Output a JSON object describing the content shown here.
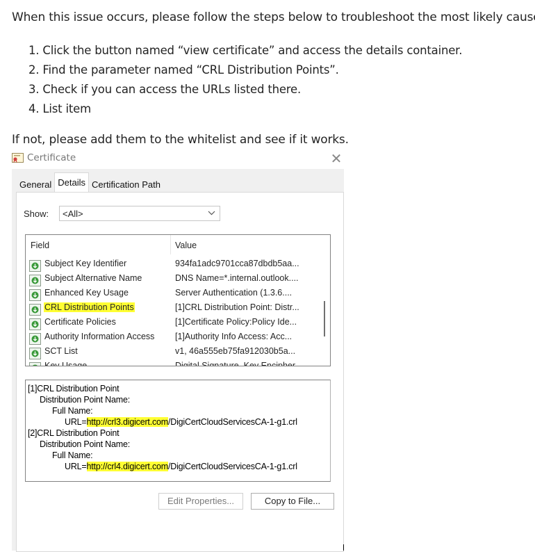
{
  "instructions": {
    "intro": "When this issue occurs, please follow the steps below to troubleshoot the most likely cause.",
    "steps": [
      "Click the button named “view certificate” and access the details container.",
      "Find the parameter named “CRL Distribution Points”.",
      "Check if you can access the URLs listed there.",
      "List item"
    ],
    "outro": "If not, please add them to the whitelist and see if it works."
  },
  "dialog": {
    "title": "Certificate",
    "close_glyph": "✕",
    "tabs": [
      "General",
      "Details",
      "Certification Path"
    ],
    "active_tab": "Details",
    "show_label": "Show:",
    "show_value": "<All>",
    "columns": {
      "field": "Field",
      "value": "Value"
    },
    "rows": [
      {
        "field": "Subject Key Identifier",
        "value": "934fa1adc9701cca87dbdb5aa..."
      },
      {
        "field": "Subject Alternative Name",
        "value": "DNS Name=*.internal.outlook...."
      },
      {
        "field": "Enhanced Key Usage",
        "value": "Server Authentication (1.3.6...."
      },
      {
        "field": "CRL Distribution Points",
        "value": "[1]CRL Distribution Point: Distr...",
        "highlighted": true
      },
      {
        "field": "Certificate Policies",
        "value": "[1]Certificate Policy:Policy Ide..."
      },
      {
        "field": "Authority Information Access",
        "value": "[1]Authority Info Access: Acc..."
      },
      {
        "field": "SCT List",
        "value": "v1, 46a555eb75fa912030b5a..."
      },
      {
        "field": "Key Usage",
        "value": "Digital Signature, Key Encipher..."
      }
    ],
    "detail": {
      "l1": "[1]CRL Distribution Point",
      "l2": "Distribution Point Name:",
      "l3": "Full Name:",
      "l4_prefix": "URL=",
      "l4_link": "http://crl3.digicert.com",
      "l4_suffix": "/DigiCertCloudServicesCA-1-g1.crl",
      "l5": "[2]CRL Distribution Point",
      "l6": "Distribution Point Name:",
      "l7": "Full Name:",
      "l8_prefix": "URL=",
      "l8_link": "http://crl4.digicert.com",
      "l8_suffix": "/DigiCertCloudServicesCA-1-g1.crl"
    },
    "buttons": {
      "edit_properties": "Edit Properties...",
      "copy_to_file": "Copy to File..."
    }
  },
  "colors": {
    "highlight": "#ffff33",
    "link": "#0066cc",
    "icon_green": "#3a9a3a"
  }
}
